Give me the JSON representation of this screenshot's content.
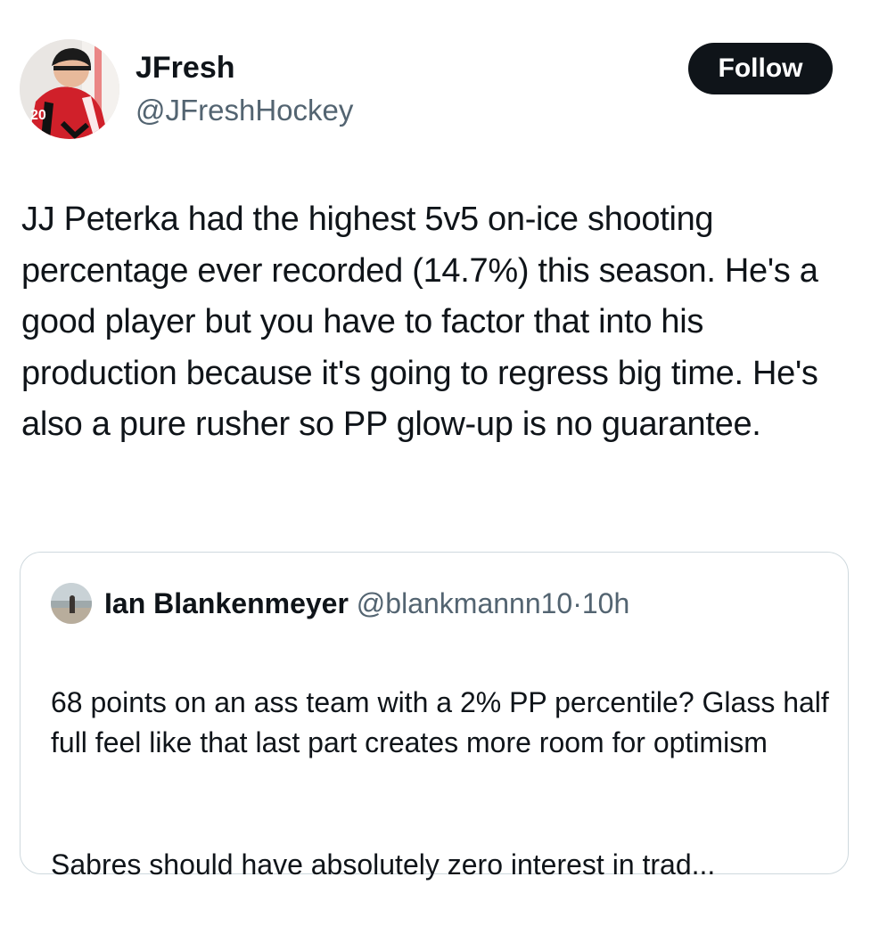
{
  "author": {
    "display_name": "JFresh",
    "handle": "@JFreshHockey",
    "avatar_icon": "hockey-player-avatar"
  },
  "follow_button": {
    "label": "Follow"
  },
  "tweet": {
    "text": "JJ Peterka had the highest 5v5 on-ice shooting percentage ever recorded (14.7%) this season. He's a good player but you have to factor that into his production because it's going to regress big time. He's also a pure rusher so PP glow-up is no guarantee."
  },
  "quote": {
    "display_name": "Ian Blankenmeyer",
    "handle": "@blankmannn10",
    "separator": "·",
    "time": "10h",
    "avatar_icon": "beach-photo-avatar",
    "paragraph_1": "68 points on an ass team with a 2% PP percentile? Glass half full feel like that last part creates more room for optimism",
    "paragraph_2": "Sabres should have absolutely zero interest in trad..."
  },
  "colors": {
    "text_primary": "#0f1419",
    "text_secondary": "#536471",
    "button_bg": "#0f1419",
    "button_text": "#ffffff",
    "border": "#cfd9de",
    "avatar_jersey_red": "#d0202a"
  }
}
